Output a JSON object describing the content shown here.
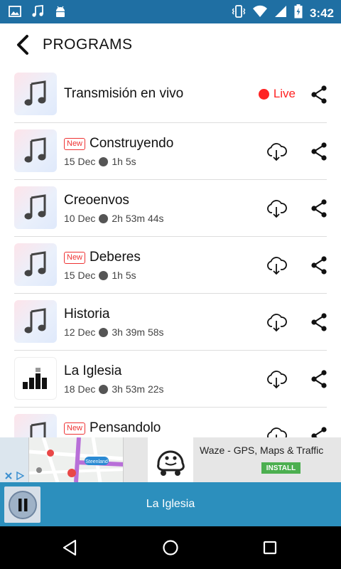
{
  "status_bar": {
    "time": "3:42"
  },
  "header": {
    "title": "PROGRAMS"
  },
  "programs": [
    {
      "title": "Transmisión en vivo",
      "live_label": "Live"
    },
    {
      "badge": "New",
      "title": "Construyendo",
      "date": "15 Dec",
      "duration": "1h 5s"
    },
    {
      "title": "Creoenvos",
      "date": "10 Dec",
      "duration": "2h 53m 44s"
    },
    {
      "badge": "New",
      "title": "Deberes",
      "date": "15 Dec",
      "duration": "1h 5s"
    },
    {
      "title": "Historia",
      "date": "12 Dec",
      "duration": "3h 39m 58s"
    },
    {
      "title": "La Iglesia",
      "date": "18 Dec",
      "duration": "3h 53m 22s"
    },
    {
      "badge": "New",
      "title": "Pensandolo"
    }
  ],
  "ad": {
    "title": "Waze - GPS, Maps & Traffic",
    "install_label": "INSTALL",
    "map_label": "Steenland"
  },
  "player": {
    "title": "La Iglesia"
  },
  "colors": {
    "status_bar": "#1f6fa3",
    "player": "#2c8fbd",
    "live": "#ff2222",
    "badge": "#ee3333",
    "install": "#4caf50"
  }
}
